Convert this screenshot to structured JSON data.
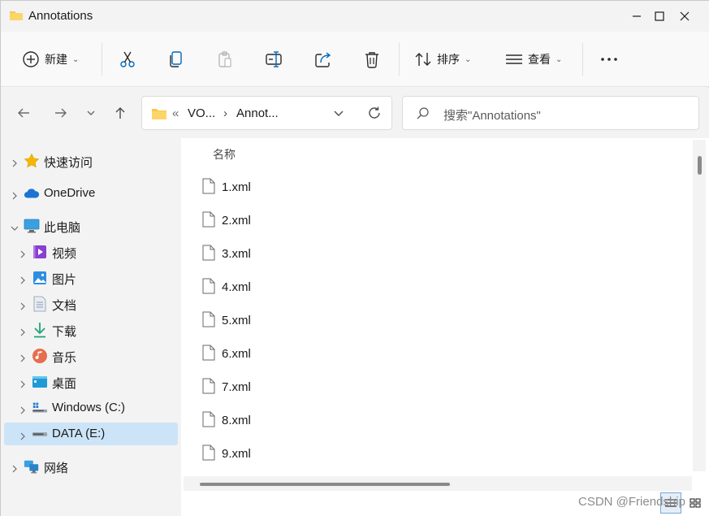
{
  "window": {
    "title": "Annotations",
    "controls": [
      "minimize",
      "maximize",
      "close"
    ]
  },
  "toolbar": {
    "new_label": "新建",
    "sort_label": "排序",
    "view_label": "查看",
    "more_label": "···",
    "icons": [
      "cut-icon",
      "copy-icon",
      "paste-icon",
      "rename-icon",
      "share-icon",
      "delete-icon"
    ]
  },
  "address": {
    "overflow": "«",
    "crumbs": [
      "VO...",
      "Annot..."
    ],
    "separator": "›"
  },
  "search": {
    "placeholder": "搜索\"Annotations\""
  },
  "sidebar": {
    "items": [
      {
        "label": "快速访问",
        "icon": "star-icon"
      },
      {
        "label": "OneDrive",
        "icon": "cloud-icon"
      },
      {
        "label": "此电脑",
        "icon": "pc-icon"
      },
      {
        "label": "视频",
        "icon": "video-icon"
      },
      {
        "label": "图片",
        "icon": "pictures-icon"
      },
      {
        "label": "文档",
        "icon": "documents-icon"
      },
      {
        "label": "下载",
        "icon": "download-icon"
      },
      {
        "label": "音乐",
        "icon": "music-icon"
      },
      {
        "label": "桌面",
        "icon": "desktop-icon"
      },
      {
        "label": "Windows (C:)",
        "icon": "drive-c-icon"
      },
      {
        "label": "DATA (E:)",
        "icon": "drive-e-icon"
      },
      {
        "label": "网络",
        "icon": "network-icon"
      }
    ],
    "selected": "DATA (E:)"
  },
  "main": {
    "column_header": "名称",
    "files": [
      "1.xml",
      "2.xml",
      "3.xml",
      "4.xml",
      "5.xml",
      "6.xml",
      "7.xml",
      "8.xml",
      "9.xml"
    ]
  },
  "watermark": "CSDN @Friendship",
  "colors": {
    "accent": "#0067c0",
    "selected_bg": "#cce4f7",
    "folder": "#f8c84a"
  }
}
